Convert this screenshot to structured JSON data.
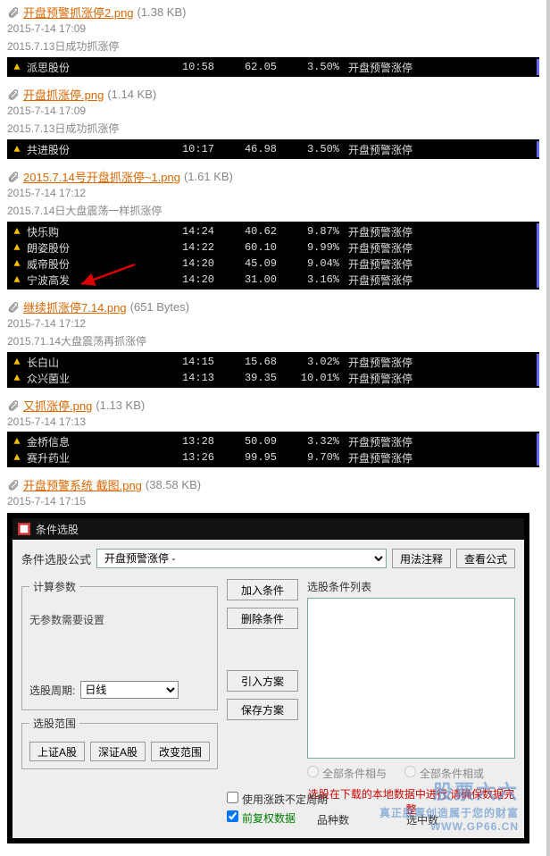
{
  "sections": [
    {
      "filename": "开盘预警抓涨停2.png",
      "filesize": "(1.38 KB)",
      "timestamp": "2015-7-14 17:09",
      "caption": "2015.7.13日成功抓涨停",
      "rows": [
        {
          "name": "派思股份",
          "time": "10:58",
          "price": "62.05",
          "pct": "3.50%",
          "label": "开盘预警涨停"
        }
      ]
    },
    {
      "filename": "开盘抓涨停.png",
      "filesize": "(1.14 KB)",
      "timestamp": "2015-7-14 17:09",
      "caption": "2015.7.13日成功抓涨停",
      "rows": [
        {
          "name": "共进股份",
          "time": "10:17",
          "price": "46.98",
          "pct": "3.50%",
          "label": "开盘预警涨停"
        }
      ]
    },
    {
      "filename": "2015.7.14号开盘抓涨停~1.png",
      "filesize": "(1.61 KB)",
      "timestamp": "2015-7-14 17:12",
      "caption": "2015.7.14日大盘震荡一样抓涨停",
      "arrow": true,
      "rows": [
        {
          "name": "快乐购",
          "time": "14:24",
          "price": "40.62",
          "pct": "9.87%",
          "label": "开盘预警涨停"
        },
        {
          "name": "朗姿股份",
          "time": "14:22",
          "price": "60.10",
          "pct": "9.99%",
          "label": "开盘预警涨停"
        },
        {
          "name": "威帝股份",
          "time": "14:20",
          "price": "45.09",
          "pct": "9.04%",
          "label": "开盘预警涨停"
        },
        {
          "name": "宁波高发",
          "time": "14:20",
          "price": "31.00",
          "pct": "3.16%",
          "label": "开盘预警涨停"
        }
      ]
    },
    {
      "filename": "继续抓涨停7.14.png",
      "filesize": "(651 Bytes)",
      "timestamp": "2015-7-14 17:12",
      "caption": "2015.71.14大盘震荡再抓涨停",
      "rows": [
        {
          "name": "长白山",
          "time": "14:15",
          "price": "15.68",
          "pct": "3.02%",
          "label": "开盘预警涨停"
        },
        {
          "name": "众兴菌业",
          "time": "14:13",
          "price": "39.35",
          "pct": "10.01%",
          "label": "开盘预警涨停"
        }
      ]
    },
    {
      "filename": "又抓涨停.png",
      "filesize": "(1.13 KB)",
      "timestamp": "2015-7-14 17:13",
      "rows": [
        {
          "name": "金桥信息",
          "time": "13:28",
          "price": "50.09",
          "pct": "3.32%",
          "label": "开盘预警涨停"
        },
        {
          "name": "赛升药业",
          "time": "13:26",
          "price": "99.95",
          "pct": "9.70%",
          "label": "开盘预警涨停"
        }
      ]
    },
    {
      "filename": "开盘预警系统 截图.png",
      "filesize": "(38.58 KB)",
      "timestamp": "2015-7-14 17:15",
      "dialog": true
    }
  ],
  "dialog": {
    "title": "条件选股",
    "formula_label": "条件选股公式",
    "formula_value": "开盘预警涨停 -",
    "btn_usage": "用法注释",
    "btn_view": "查看公式",
    "fieldset_params": "计算参数",
    "no_params_text": "无参数需要设置",
    "period_label": "选股周期:",
    "period_value": "日线",
    "fieldset_range": "选股范围",
    "range_sha": "上证A股",
    "range_sza": "深证A股",
    "btn_change_range": "改变范围",
    "btn_add": "加入条件",
    "btn_del": "删除条件",
    "btn_import": "引入方案",
    "btn_save": "保存方案",
    "list_label": "选股条件列表",
    "radio_and": "全部条件相与",
    "radio_or": "全部条件相或",
    "warning": "选股在下载的本地数据中进行,请确保数据完整",
    "opt_fixed_period": "使用涨跌不定周期",
    "opt_fq": "前复权数据",
    "opt_pzs": "品种数",
    "opt_xzs": "选中数"
  },
  "watermark": {
    "main": "股票六六",
    "slogan": "真正股票创造属于您的财富",
    "url": "WWW.GP66.CN"
  }
}
